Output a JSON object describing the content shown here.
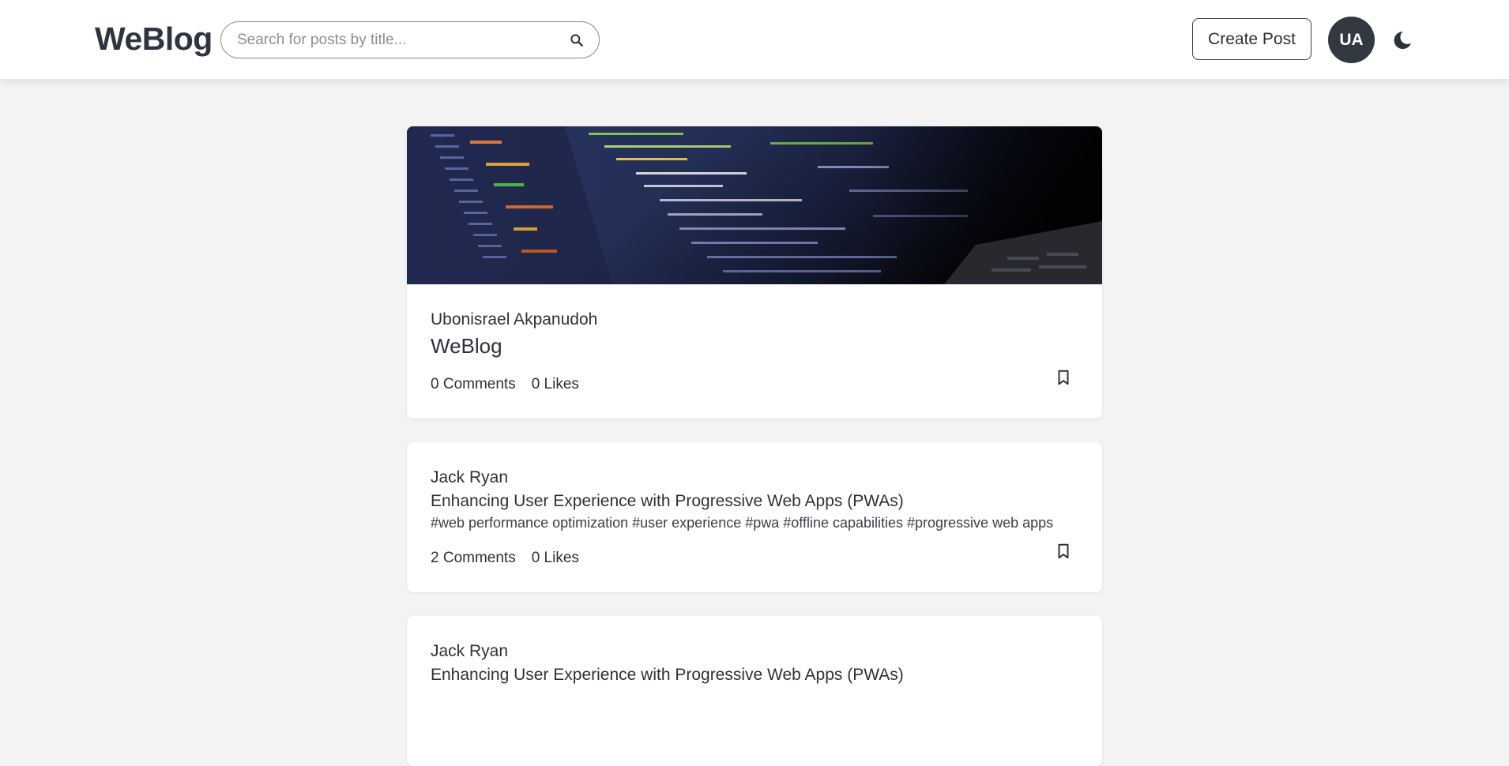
{
  "header": {
    "logo": "WeBlog",
    "search_placeholder": "Search for posts by title...",
    "create_post_label": "Create Post",
    "avatar_initials": "UA"
  },
  "posts": [
    {
      "has_cover": true,
      "author": "Ubonisrael Akpanudoh",
      "title": "WeBlog",
      "tags": "",
      "comments": "0 Comments",
      "likes": "0 Likes"
    },
    {
      "has_cover": false,
      "author": "Jack Ryan",
      "title": "Enhancing User Experience with Progressive Web Apps (PWAs)",
      "tags": "#web performance optimization #user experience #pwa #offline capabilities #progressive web apps",
      "comments": "2 Comments",
      "likes": "0 Likes"
    },
    {
      "has_cover": false,
      "author": "Jack Ryan",
      "title": "Enhancing User Experience with Progressive Web Apps (PWAs)",
      "tags": "",
      "comments": "",
      "likes": ""
    }
  ],
  "colors": {
    "page_bg": "#f3f3f3",
    "card_bg": "#ffffff",
    "avatar_bg": "#333941",
    "text": "#2d3139"
  },
  "icons": {
    "search": "search-icon",
    "theme": "moon-icon",
    "bookmark": "bookmark-icon"
  }
}
